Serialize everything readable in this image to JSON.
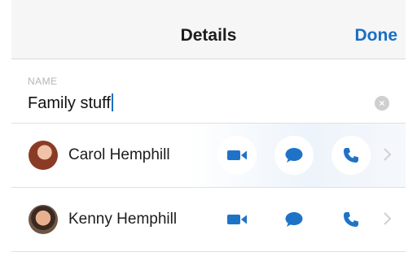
{
  "navbar": {
    "title": "Details",
    "done_label": "Done"
  },
  "name_section": {
    "label": "NAME",
    "value": "Family stuff"
  },
  "contacts": [
    {
      "name": "Carol Hemphill"
    },
    {
      "name": "Kenny Hemphill"
    }
  ],
  "icons": {
    "video": "video-camera-icon",
    "message": "message-bubble-icon",
    "call": "phone-icon",
    "clear": "clear-icon",
    "chevron": "chevron-right-icon"
  },
  "colors": {
    "accent": "#1a6fc4",
    "icon_blue": "#1f73c7"
  }
}
